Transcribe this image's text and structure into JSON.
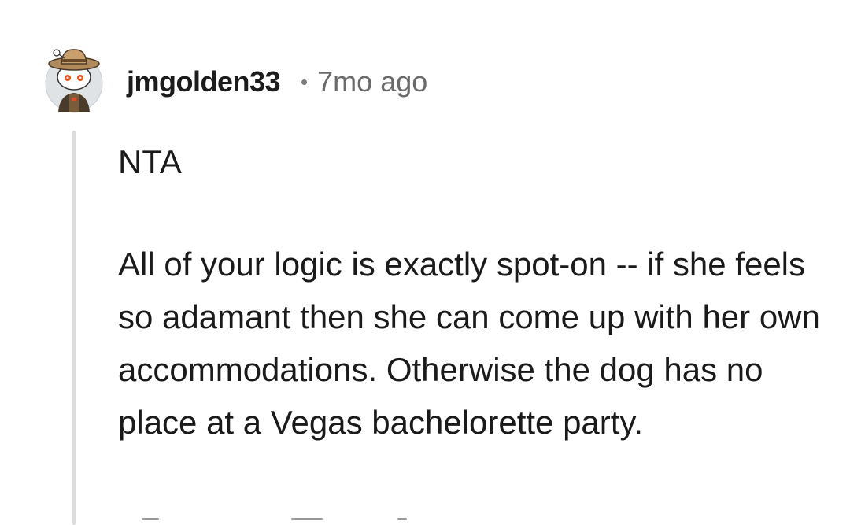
{
  "comment": {
    "username": "jmgolden33",
    "separator": "•",
    "timestamp": "7mo ago",
    "verdict": "NTA",
    "body": "All of your logic is exactly spot-on -- if she feels so adamant then she can come up with her own accommodations. Otherwise the dog has no place at a Vegas bachelorette party."
  },
  "avatar": {
    "icon": "snoo-cowboy-avatar-icon"
  },
  "colors": {
    "text": "#1a1a1b",
    "meta": "#6a6a6a",
    "thread_line": "#dcdcdc"
  }
}
